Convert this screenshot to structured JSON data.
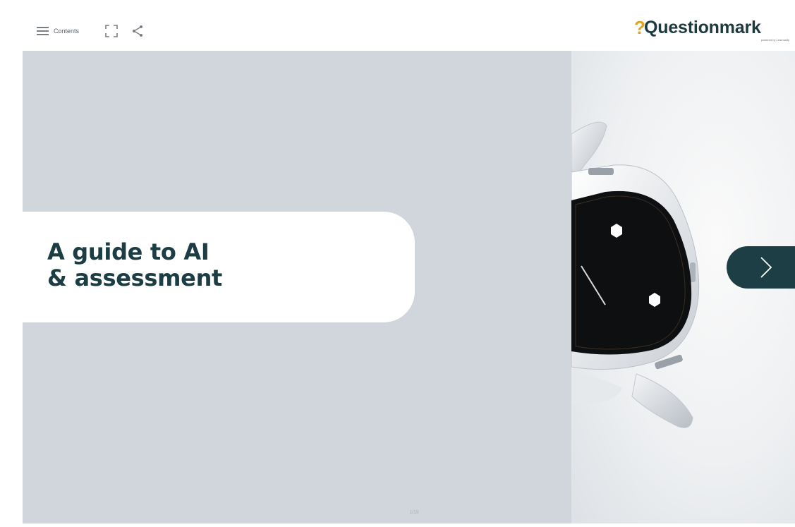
{
  "toolbar": {
    "contents_label": "Contents",
    "menu_icon": "hamburger-menu-icon",
    "fullscreen_icon": "fullscreen-icon",
    "share_icon": "share-icon"
  },
  "brand": {
    "mark": "?",
    "name": "Questionmark",
    "tagline": "powered by Learnosity",
    "mark_color": "#e0a422",
    "text_color": "#1d3a40"
  },
  "slide": {
    "title_line1": "A guide to AI",
    "title_line2": "& assessment",
    "title_color": "#1c3d43",
    "panel_color": "#d1d6dc",
    "page_indicator": "1/18"
  },
  "navigation": {
    "next_icon": "chevron-right-icon",
    "button_color": "#1d3e45"
  }
}
